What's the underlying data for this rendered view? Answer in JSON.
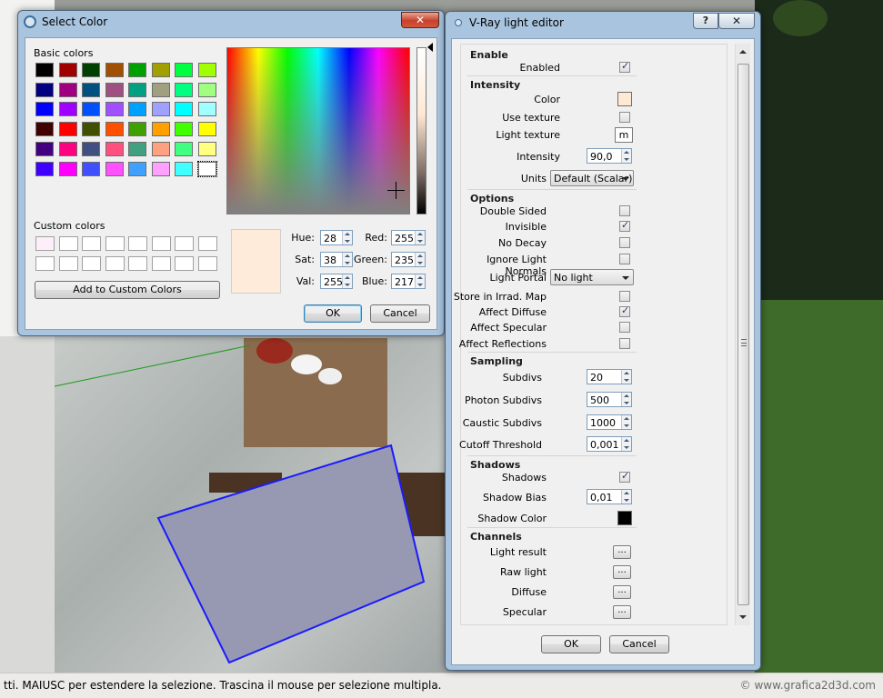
{
  "status_bar": {
    "text": "tti. MAIUSC per estendere la selezione. Trascina il mouse per selezione multipla.",
    "watermark": "© www.grafica2d3d.com"
  },
  "select_color": {
    "title": "Select Color",
    "close_label": "✕",
    "basic_colors_label": "Basic colors",
    "custom_colors_label": "Custom colors",
    "basic_colors": [
      [
        "#000000",
        "#a00000",
        "#004000",
        "#a05000",
        "#00a000",
        "#a0a000",
        "#00ff40",
        "#a0ff00"
      ],
      [
        "#000080",
        "#a00080",
        "#005080",
        "#a05080",
        "#00a080",
        "#a0a080",
        "#00ff80",
        "#a0ff80"
      ],
      [
        "#0000ff",
        "#a000ff",
        "#0050ff",
        "#a050ff",
        "#00a0ff",
        "#a0a0ff",
        "#00ffff",
        "#a0ffff"
      ],
      [
        "#400000",
        "#ff0000",
        "#405000",
        "#ff5000",
        "#40a000",
        "#ffa000",
        "#40ff00",
        "#ffff00"
      ],
      [
        "#400080",
        "#ff0080",
        "#405080",
        "#ff5080",
        "#40a080",
        "#ffa080",
        "#40ff80",
        "#ffff80"
      ],
      [
        "#4000ff",
        "#ff00ff",
        "#4050ff",
        "#ff50ff",
        "#40a0ff",
        "#ffa0ff",
        "#40ffff",
        "#ffffff"
      ]
    ],
    "custom_colors": [
      "#fdeefa",
      "#ffffff",
      "#ffffff",
      "#ffffff",
      "#ffffff",
      "#ffffff",
      "#ffffff",
      "#ffffff",
      "#ffffff",
      "#ffffff",
      "#ffffff",
      "#ffffff",
      "#ffffff",
      "#ffffff",
      "#ffffff",
      "#ffffff"
    ],
    "add_custom_label": "Add to Custom Colors",
    "preview_color": "#ffebd9",
    "hue_label": "Hue:",
    "hue": "28",
    "sat_label": "Sat:",
    "sat": "38",
    "val_label": "Val:",
    "val": "255",
    "red_label": "Red:",
    "red": "255",
    "green_label": "Green:",
    "green": "235",
    "blue_label": "Blue:",
    "blue": "217",
    "ok_label": "OK",
    "cancel_label": "Cancel"
  },
  "vray": {
    "title": "V-Ray light editor",
    "help_label": "?",
    "close_label": "✕",
    "enable": {
      "header": "Enable",
      "enabled_label": "Enabled",
      "enabled": true
    },
    "intensity": {
      "header": "Intensity",
      "color_label": "Color",
      "color": "#ffe8d4",
      "use_texture_label": "Use texture",
      "use_texture": false,
      "light_texture_label": "Light texture",
      "light_texture_btn": "m",
      "intensity_label": "Intensity",
      "intensity_value": "90,0",
      "units_label": "Units",
      "units_value": "Default (Scalar)"
    },
    "options": {
      "header": "Options",
      "double_sided_label": "Double Sided",
      "double_sided": false,
      "invisible_label": "Invisible",
      "invisible": true,
      "no_decay_label": "No Decay",
      "no_decay": false,
      "ignore_normals_label": "Ignore Light Normals",
      "ignore_normals": false,
      "light_portal_label": "Light Portal",
      "light_portal_value": "No light",
      "store_irrad_label": "Store in Irrad. Map",
      "store_irrad": false,
      "affect_diffuse_label": "Affect Diffuse",
      "affect_diffuse": true,
      "affect_specular_label": "Affect Specular",
      "affect_specular": false,
      "affect_reflections_label": "Affect Reflections",
      "affect_reflections": false
    },
    "sampling": {
      "header": "Sampling",
      "subdivs_label": "Subdivs",
      "subdivs": "20",
      "photon_label": "Photon Subdivs",
      "photon": "500",
      "caustic_label": "Caustic Subdivs",
      "caustic": "1000",
      "cutoff_label": "Cutoff Threshold",
      "cutoff": "0,001"
    },
    "shadows": {
      "header": "Shadows",
      "shadows_label": "Shadows",
      "shadows": true,
      "bias_label": "Shadow Bias",
      "bias": "0,01",
      "color_label": "Shadow Color",
      "color": "#000000"
    },
    "channels": {
      "header": "Channels",
      "light_result_label": "Light result",
      "raw_light_label": "Raw light",
      "diffuse_label": "Diffuse",
      "specular_label": "Specular",
      "button_label": "..."
    },
    "ok_label": "OK",
    "cancel_label": "Cancel"
  }
}
